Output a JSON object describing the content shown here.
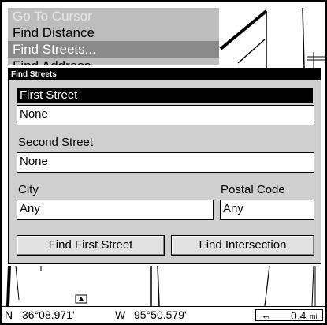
{
  "menu": {
    "items": [
      {
        "label": "Go To Cursor",
        "state": "disabled"
      },
      {
        "label": "Find Distance",
        "state": "normal"
      },
      {
        "label": "Find Streets...",
        "state": "selected"
      },
      {
        "label": "Find Address",
        "state": "normal"
      }
    ]
  },
  "dialog": {
    "title": "Find Streets",
    "first_street": {
      "label": "First Street",
      "value": "None"
    },
    "second_street": {
      "label": "Second Street",
      "value": "None"
    },
    "city": {
      "label": "City",
      "value": "Any"
    },
    "postal_code": {
      "label": "Postal Code",
      "value": "Any"
    },
    "buttons": {
      "find_first": "Find First Street",
      "find_intersection": "Find Intersection"
    }
  },
  "status": {
    "lat_hemisphere": "N",
    "lat": "36°08.971'",
    "lon_hemisphere": "W",
    "lon": "95°50.579'",
    "scale_icon": "↔",
    "scale_value": "0.4",
    "scale_unit": "mi"
  }
}
